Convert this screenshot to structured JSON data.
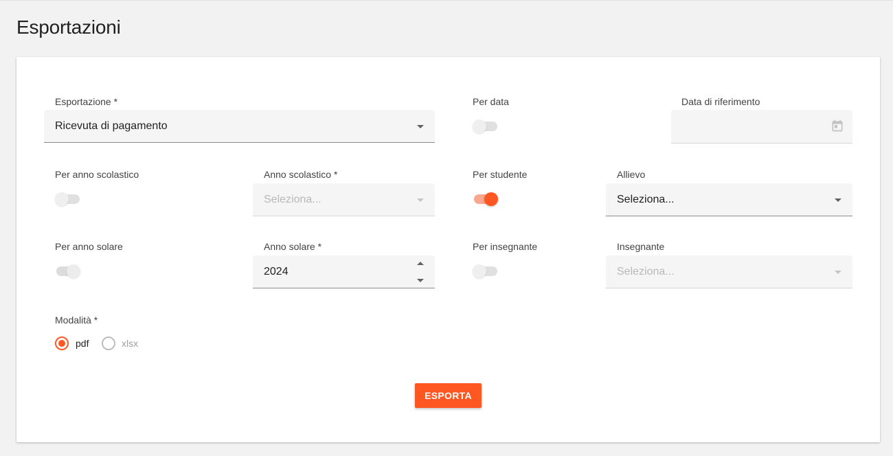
{
  "page": {
    "title": "Esportazioni"
  },
  "form": {
    "export": {
      "label": "Esportazione *",
      "value": "Ricevuta di pagamento"
    },
    "by_date": {
      "label": "Per data",
      "on": false
    },
    "reference_date": {
      "label": "Data di riferimento",
      "value": ""
    },
    "by_school_year": {
      "label": "Per anno scolastico",
      "on": false
    },
    "school_year": {
      "label": "Anno scolastico *",
      "placeholder": "Seleziona..."
    },
    "by_student": {
      "label": "Per studente",
      "on": true
    },
    "student": {
      "label": "Allievo",
      "value": "Seleziona..."
    },
    "by_solar_year": {
      "label": "Per anno solare",
      "on": false
    },
    "solar_year": {
      "label": "Anno solare *",
      "value": "2024"
    },
    "by_teacher": {
      "label": "Per insegnante",
      "on": false
    },
    "teacher": {
      "label": "Insegnante",
      "placeholder": "Seleziona..."
    },
    "mode": {
      "label": "Modalità *",
      "options": [
        {
          "label": "pdf",
          "selected": true
        },
        {
          "label": "xlsx",
          "selected": false
        }
      ]
    },
    "submit_label": "ESPORTA"
  },
  "colors": {
    "accent": "#ff5722",
    "accent_track": "#f9a88f"
  },
  "icons": {
    "date": "calendar-icon",
    "dropdown": "caret-down-icon"
  }
}
